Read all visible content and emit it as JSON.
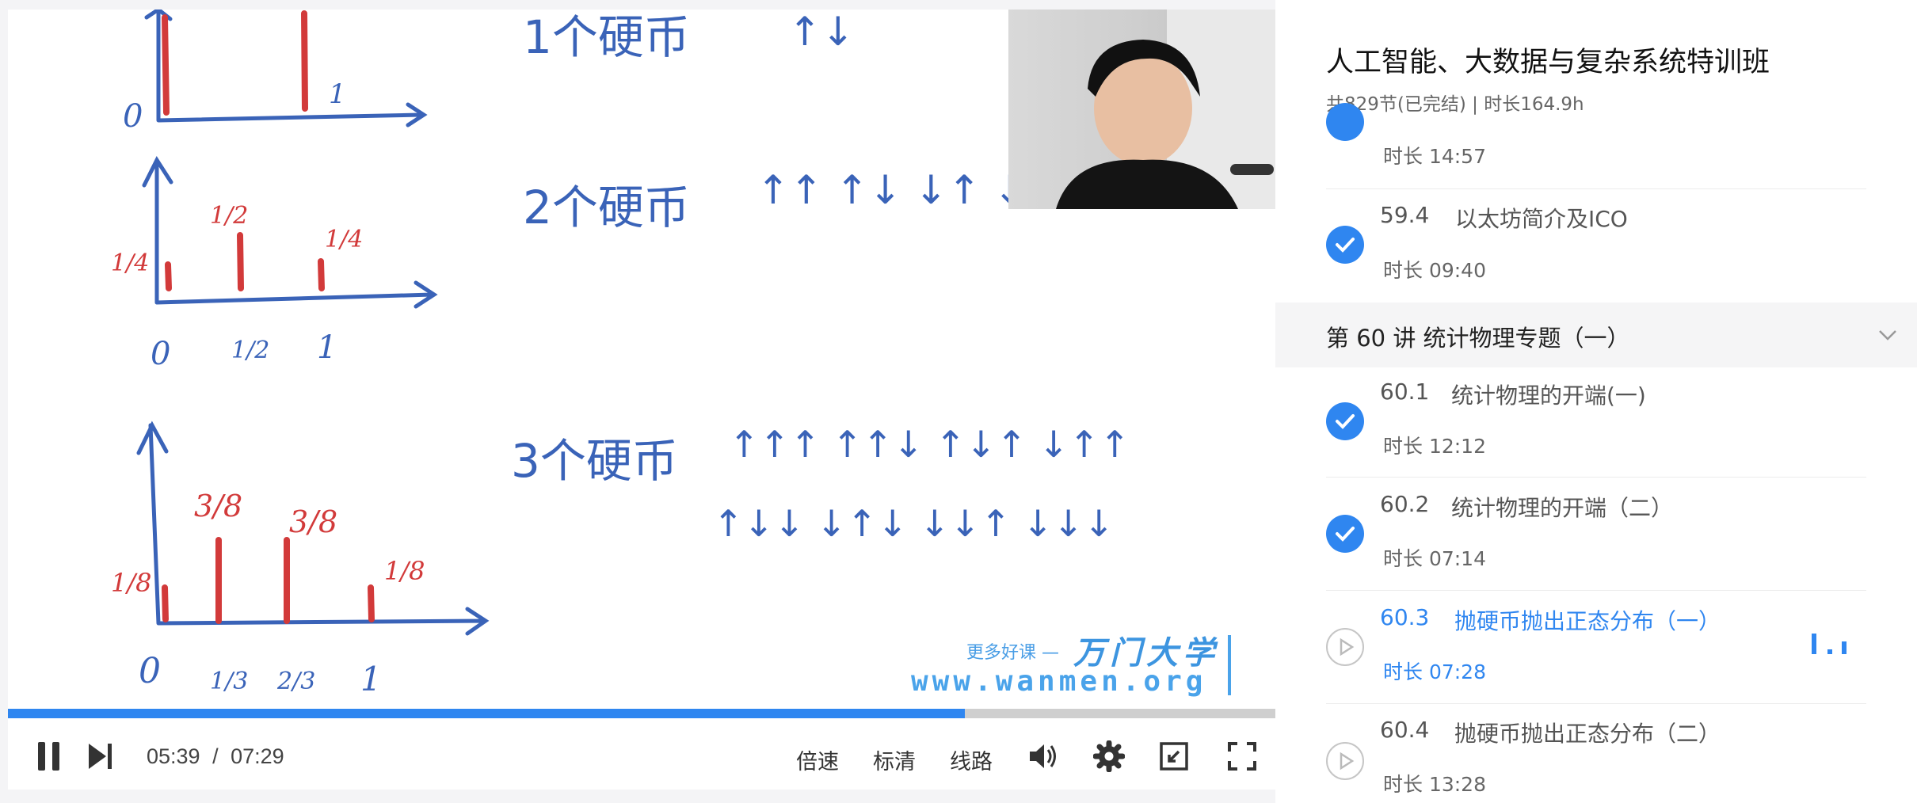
{
  "player": {
    "watermark": {
      "slogan": "更多好课 —",
      "brand": "万门大学",
      "url": "www.wanmen.org"
    },
    "progress": 0.755,
    "current_time": "05:39",
    "separator": "/",
    "total_time": "07:29",
    "speed_label": "倍速",
    "quality_label": "标清",
    "route_label": "线路",
    "accent_color": "#2f86f0"
  },
  "sidebar": {
    "course_title": "人工智能、大数据与复杂系统特训班",
    "course_meta": "共829节(已完结) | 时长164.9h",
    "lessons_before": [
      {
        "num": "",
        "name": "",
        "duration": "时长 14:57",
        "status": "done"
      },
      {
        "num": "59.4",
        "name": "以太坊简介及ICO",
        "duration": "时长 09:40",
        "status": "done"
      }
    ],
    "section": {
      "label": "第 60 讲   统计物理专题（一）",
      "icon": "chevron-down-icon"
    },
    "lessons": [
      {
        "num": "60.1",
        "name": "统计物理的开端(一)",
        "duration": "时长 12:12",
        "status": "done"
      },
      {
        "num": "60.2",
        "name": "统计物理的开端（二）",
        "duration": "时长 07:14",
        "status": "done"
      },
      {
        "num": "60.3",
        "name": "抛硬币抛出正态分布（一）",
        "duration": "时长 07:28",
        "status": "playing"
      },
      {
        "num": "60.4",
        "name": "抛硬币抛出正态分布（二）",
        "duration": "时长 13:28",
        "status": "unplayed"
      }
    ]
  }
}
